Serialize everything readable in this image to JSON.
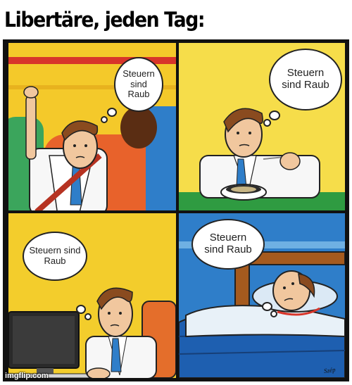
{
  "meme": {
    "title": "Libertäre, jeden Tag:",
    "panels": [
      {
        "thought": "Steuern sind Raub"
      },
      {
        "thought": "Steuern sind Raub"
      },
      {
        "thought": "Steuern sind Raub"
      },
      {
        "thought": "Steuern sind Raub"
      }
    ],
    "watermark": "imgflip.com"
  }
}
